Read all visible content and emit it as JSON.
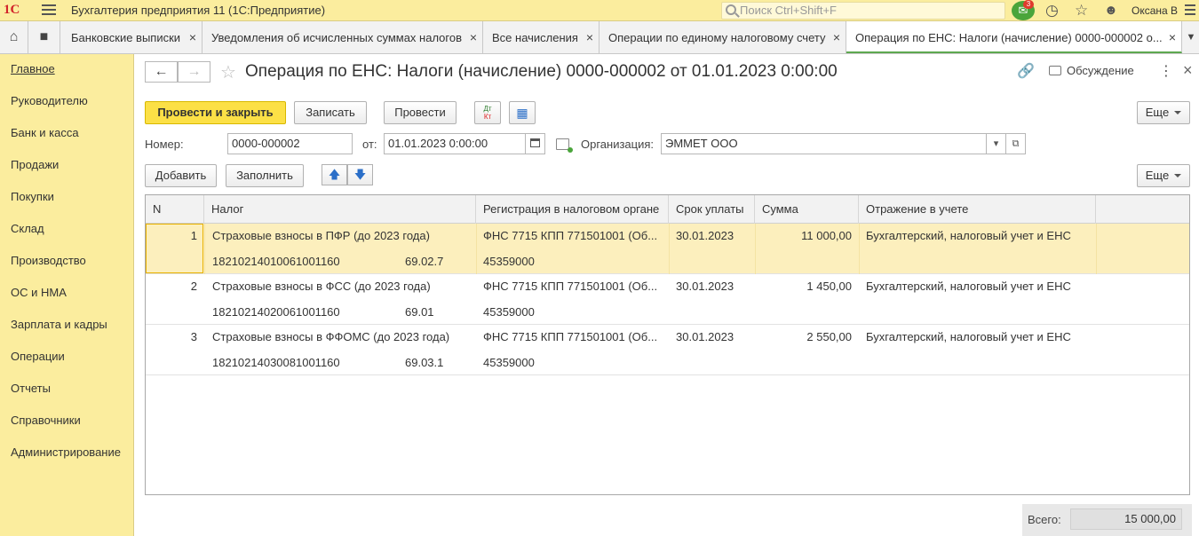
{
  "window": {
    "title": "Бухгалтерия предприятия 11  (1С:Предприятие)",
    "search_placeholder": "Поиск Ctrl+Shift+F",
    "notifications_count": "3",
    "user": "Оксана В"
  },
  "tabs": [
    {
      "label": "Банковские выписки"
    },
    {
      "label": "Уведомления об исчисленных суммах налогов"
    },
    {
      "label": "Все начисления"
    },
    {
      "label": "Операции по единому налоговому счету"
    },
    {
      "label": "Операция по ЕНС: Налоги (начисление) 0000-000002 о..."
    }
  ],
  "sidebar": {
    "items": [
      {
        "label": "Главное"
      },
      {
        "label": "Руководителю"
      },
      {
        "label": "Банк и касса"
      },
      {
        "label": "Продажи"
      },
      {
        "label": "Покупки"
      },
      {
        "label": "Склад"
      },
      {
        "label": "Производство"
      },
      {
        "label": "ОС и НМА"
      },
      {
        "label": "Зарплата и кадры"
      },
      {
        "label": "Операции"
      },
      {
        "label": "Отчеты"
      },
      {
        "label": "Справочники"
      },
      {
        "label": "Администрирование"
      }
    ]
  },
  "doc": {
    "title": "Операция по ЕНС: Налоги (начисление) 0000-000002 от 01.01.2023 0:00:00",
    "discussion": "Обсуждение"
  },
  "toolbar": {
    "post_close": "Провести и закрыть",
    "save": "Записать",
    "post": "Провести",
    "more": "Еще"
  },
  "form": {
    "number_label": "Номер:",
    "number_value": "0000-000002",
    "date_label": "от:",
    "date_value": "01.01.2023  0:00:00",
    "org_label": "Организация:",
    "org_value": "ЭММЕТ ООО"
  },
  "table_toolbar": {
    "add": "Добавить",
    "fill": "Заполнить",
    "more": "Еще"
  },
  "table": {
    "columns": [
      "N",
      "Налог",
      "Регистрация в налоговом органе",
      "Срок уплаты",
      "Сумма",
      "Отражение в учете"
    ],
    "rows": [
      {
        "n": "1",
        "tax": "Страховые взносы в ПФР (до 2023 года)",
        "kbk": "18210214010061001160",
        "account": "69.02.7",
        "registration": "ФНС 7715 КПП 771501001 (Об...",
        "oktmo": "45359000",
        "due": "30.01.2023",
        "sum": "11 000,00",
        "reflection": "Бухгалтерский, налоговый учет и ЕНС"
      },
      {
        "n": "2",
        "tax": "Страховые взносы в ФСС (до 2023 года)",
        "kbk": "18210214020061001160",
        "account": "69.01",
        "registration": "ФНС 7715 КПП 771501001 (Об...",
        "oktmo": "45359000",
        "due": "30.01.2023",
        "sum": "1 450,00",
        "reflection": "Бухгалтерский, налоговый учет и ЕНС"
      },
      {
        "n": "3",
        "tax": "Страховые взносы в ФФОМС (до 2023 года)",
        "kbk": "18210214030081001160",
        "account": "69.03.1",
        "registration": "ФНС 7715 КПП 771501001 (Об...",
        "oktmo": "45359000",
        "due": "30.01.2023",
        "sum": "2 550,00",
        "reflection": "Бухгалтерский, налоговый учет и ЕНС"
      }
    ]
  },
  "footer": {
    "total_label": "Всего:",
    "total_value": "15 000,00"
  },
  "icons": [
    "home-icon",
    "chat-icon",
    "bell-icon",
    "history-icon",
    "star-icon",
    "user-icon",
    "link-icon",
    "discussion-icon",
    "more-icon",
    "close-icon",
    "calendar-icon",
    "arrow-up-icon",
    "arrow-down-icon"
  ]
}
